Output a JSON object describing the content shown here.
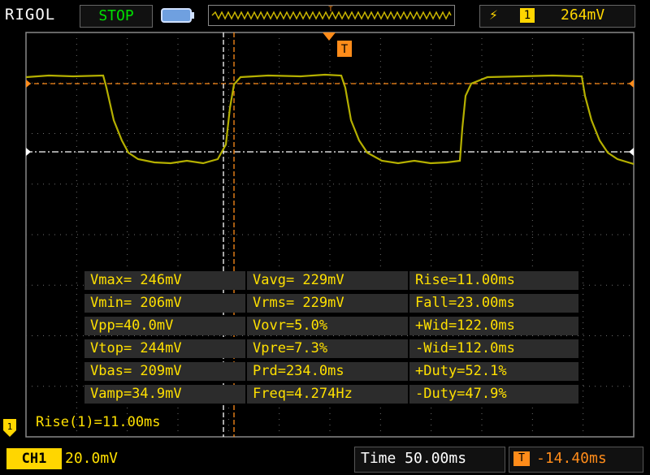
{
  "brand": "RIGOL",
  "run_state": "STOP",
  "trigger": {
    "edge_icon": "rising-edge-icon",
    "source": "1",
    "level": "264mV",
    "marker": "T"
  },
  "channel": {
    "label": "CH1",
    "scale": "20.0mV",
    "marker": "1"
  },
  "timebase": {
    "label": "Time 50.00ms",
    "offset": "-14.40ms",
    "offset_icon": "T"
  },
  "cursor_readout": "Rise(1)=11.00ms",
  "measurements": [
    [
      "Vmax= 246mV",
      "Vavg= 229mV",
      "Rise=11.00ms"
    ],
    [
      "Vmin= 206mV",
      "Vrms= 229mV",
      "Fall=23.00ms"
    ],
    [
      "Vpp=40.0mV",
      "Vovr=5.0%",
      "+Wid=122.0ms"
    ],
    [
      "Vtop= 244mV",
      "Vpre=7.3%",
      "-Wid=112.0ms"
    ],
    [
      "Vbas= 209mV",
      "Prd=234.0ms",
      "+Duty=52.1%"
    ],
    [
      "Vamp=34.9mV",
      "Freq=4.274Hz",
      "-Duty=47.9%"
    ]
  ],
  "colors": {
    "trace": "#b5b000",
    "accent_yellow": "#ffd600",
    "accent_orange": "#ff8c1a",
    "grid": "#7a7a7a"
  }
}
